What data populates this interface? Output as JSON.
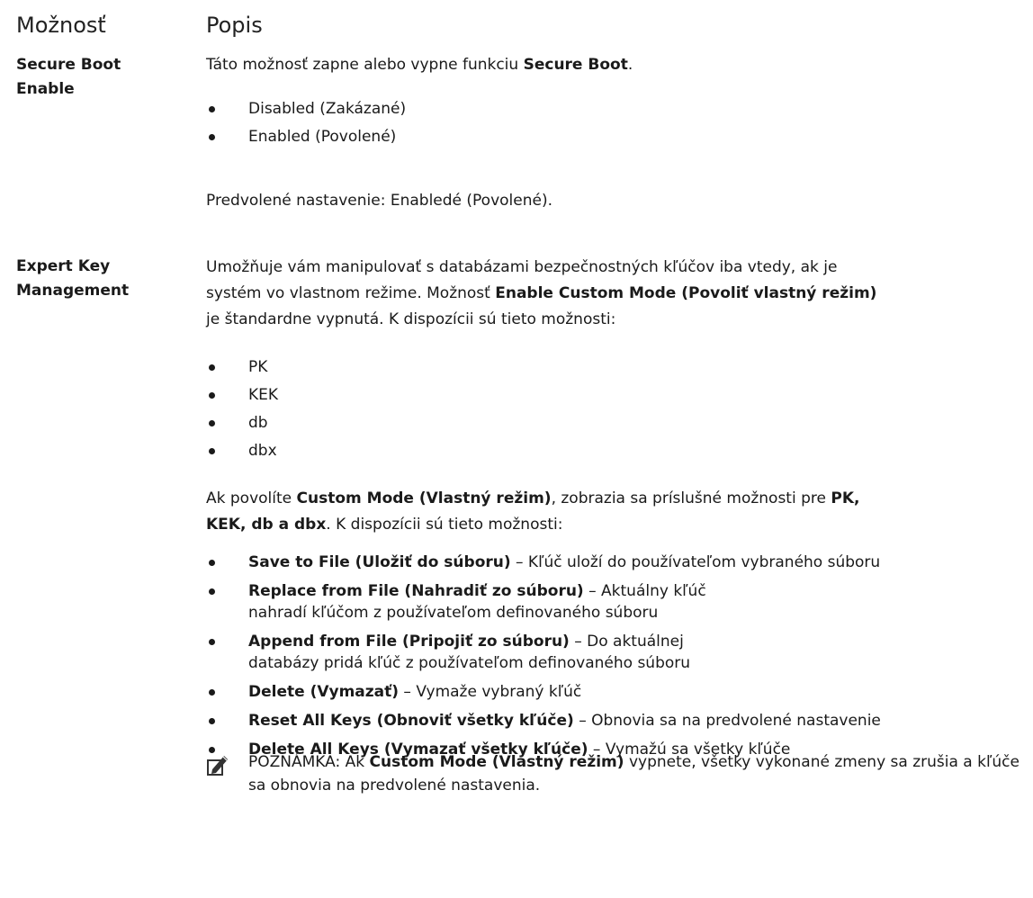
{
  "header": {
    "option": "Možnosť",
    "description": "Popis"
  },
  "rows": [
    {
      "term": [
        "Secure Boot",
        "Enable"
      ],
      "intro": {
        "pre": "Táto možnosť zapne alebo vypne funkciu ",
        "bold": "Secure Boot",
        "post": "."
      },
      "bullets": [
        "Disabled (Zakázané)",
        "Enabled (Povolené)"
      ],
      "default": "Predvolené nastavenie: Enabledé (Povolené)."
    },
    {
      "term": [
        "Expert Key",
        "Management"
      ],
      "para1": {
        "line1": "Umožňuje vám manipulovať s databázami bezpečnostných kľúčov iba vtedy, ak je",
        "line2_pre": "systém vo vlastnom režime. Možnosť ",
        "line2_bold": "Enable Custom Mode (Povoliť vlastný režim)",
        "line3": "je štandardne vypnutá. K dispozícii sú tieto možnosti:"
      },
      "keys": [
        "PK",
        "KEK",
        "db",
        "dbx"
      ],
      "para2": {
        "pre": "Ak povolíte ",
        "bold1": "Custom Mode (Vlastný režim)",
        "mid": ", zobrazia sa príslušné možnosti pre ",
        "bold2a": "PK,",
        "bold2b": "KEK, db a dbx",
        "post": ". K dispozícii sú tieto možnosti:"
      },
      "actions": [
        {
          "bold": "Save to File (Uložiť do súboru)",
          "text": " – Kľúč uloží do používateľom vybraného súboru"
        },
        {
          "bold": "Replace from File (Nahradiť zo súboru)",
          "text": " – Aktuálny kľúč nahradí kľúčom z používateľom definovaného súboru"
        },
        {
          "bold": "Append from File (Pripojiť zo súboru)",
          "text": " – Do aktuálnej databázy pridá kľúč z používateľom definovaného súboru"
        },
        {
          "bold": "Delete (Vymazať)",
          "text": " – Vymaže vybraný kľúč"
        },
        {
          "bold": "Reset All Keys (Obnoviť všetky kľúče)",
          "text": " – Obnovia sa na predvolené nastavenie"
        },
        {
          "bold": "Delete All Keys (Vymazať všetky kľúče)",
          "text": " – Vymažú sa všetky kľúče"
        }
      ],
      "note": {
        "icon": "pencil-note-icon",
        "label": "POZNÁMKA:",
        "pre": " Ak ",
        "bold": "Custom Mode (Vlastný režim)",
        "post": " vypnete, všetky vykonané zmeny sa zrušia a kľúče sa obnovia na predvolené nastavenia."
      }
    }
  ]
}
